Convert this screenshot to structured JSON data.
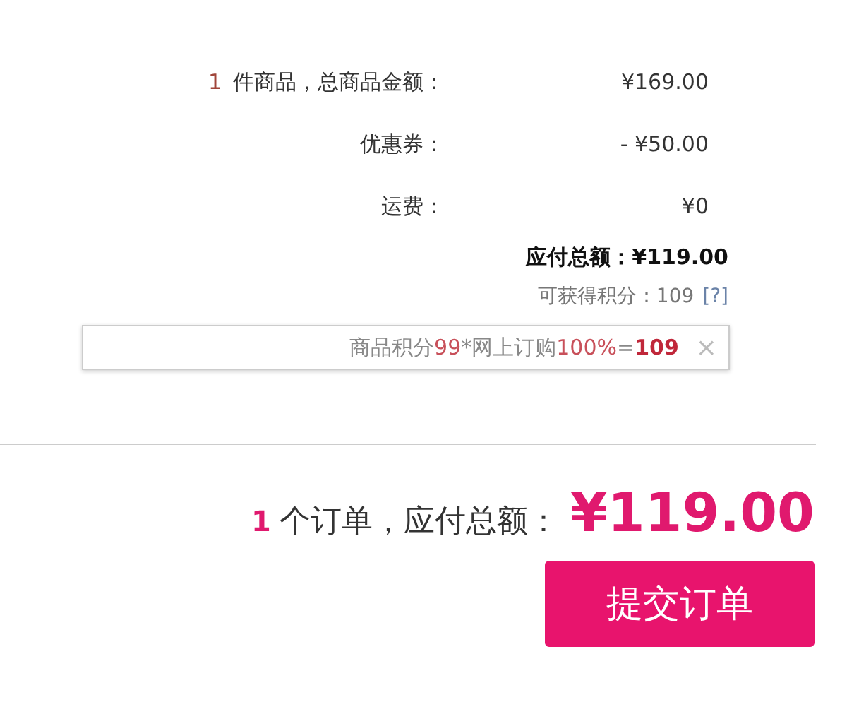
{
  "summary": {
    "rows": [
      {
        "count": "1",
        "label": "件商品，总商品金额：",
        "value": "¥169.00"
      },
      {
        "label": "优惠券：",
        "value": "- ¥50.00"
      },
      {
        "label": "运费：",
        "value": "¥0"
      }
    ],
    "payable": {
      "label": "应付总额：",
      "value": "¥119.00"
    },
    "points": {
      "label": "可获得积分：",
      "value": "109",
      "help": "[?]"
    }
  },
  "points_tip": {
    "segments": [
      {
        "kind": "text",
        "text": "商品积分"
      },
      {
        "kind": "number",
        "text": "99"
      },
      {
        "kind": "text",
        "text": "*网上订购"
      },
      {
        "kind": "number",
        "text": "100%"
      },
      {
        "kind": "text",
        "text": "="
      },
      {
        "kind": "result",
        "text": "109"
      }
    ],
    "close": "×"
  },
  "footer": {
    "order_count": "1",
    "label": "个订单，应付总额：",
    "total": "¥119.00",
    "submit": "提交订单"
  }
}
